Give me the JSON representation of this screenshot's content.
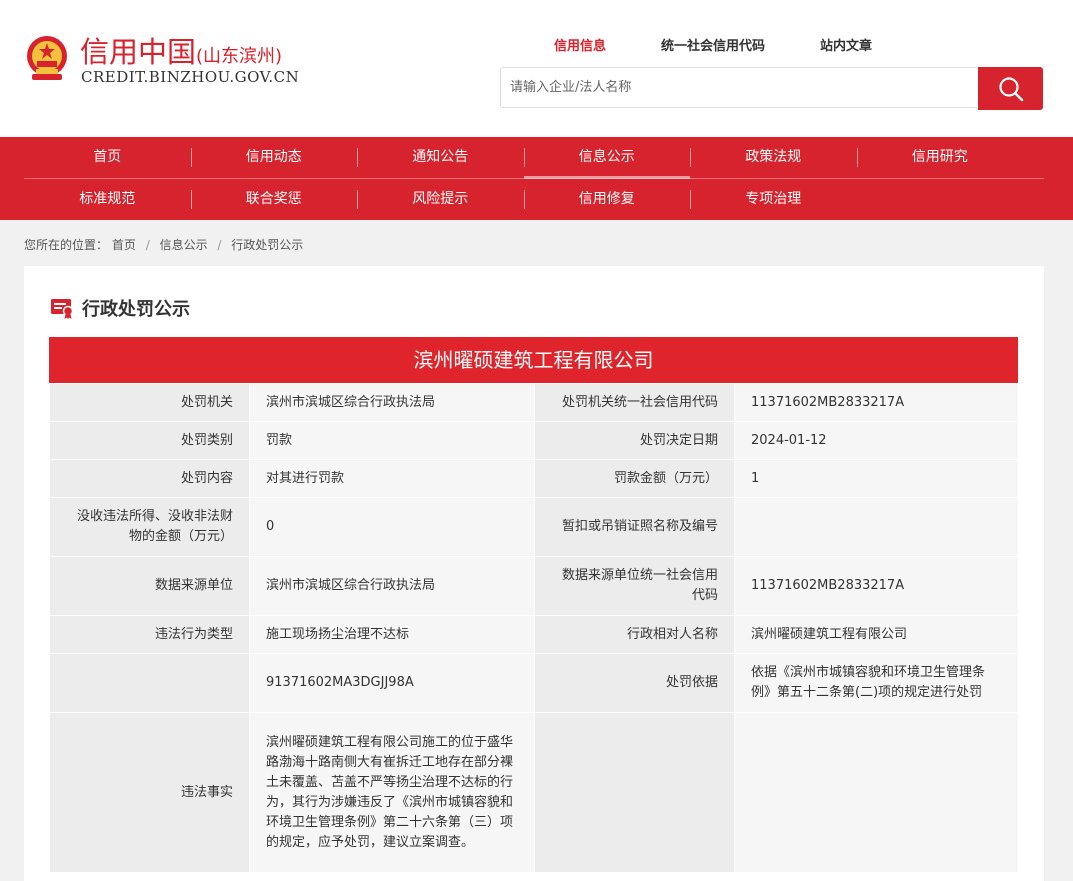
{
  "header": {
    "logo_title": "信用中国",
    "logo_region": "(山东滨州)",
    "logo_url": "CREDIT.BINZHOU.GOV.CN",
    "search_tabs": [
      "信用信息",
      "统一社会信用代码",
      "站内文章"
    ],
    "active_tab": 0,
    "search_placeholder": "请输入企业/法人名称",
    "search_value": ""
  },
  "nav": {
    "row1": [
      "首页",
      "信用动态",
      "通知公告",
      "信息公示",
      "政策法规",
      "信用研究"
    ],
    "row2": [
      "标准规范",
      "联合奖惩",
      "风险提示",
      "信用修复",
      "专项治理"
    ],
    "active": "信息公示"
  },
  "breadcrumb": {
    "prefix": "您所在的位置：",
    "items": [
      "首页",
      "信息公示",
      "行政处罚公示"
    ]
  },
  "panel": {
    "title": "行政处罚公示",
    "company": "滨州曜硕建筑工程有限公司"
  },
  "table": {
    "rows": [
      {
        "l1": "处罚机关",
        "v1": "滨州市滨城区综合行政执法局",
        "l2": "处罚机关统一社会信用代码",
        "v2": "11371602MB2833217A"
      },
      {
        "l1": "处罚类别",
        "v1": "罚款",
        "l2": "处罚决定日期",
        "v2": "2024-01-12"
      },
      {
        "l1": "处罚内容",
        "v1": "对其进行罚款",
        "l2": "罚款金额（万元）",
        "v2": "1"
      },
      {
        "l1": "没收违法所得、没收非法财物的金额（万元）",
        "v1": "0",
        "l2": "暂扣或吊销证照名称及编号",
        "v2": ""
      },
      {
        "l1": "数据来源单位",
        "v1": "滨州市滨城区综合行政执法局",
        "l2": "数据来源单位统一社会信用代码",
        "v2": "11371602MB2833217A"
      },
      {
        "l1": "违法行为类型",
        "v1": "施工现场扬尘治理不达标",
        "l2": "行政相对人名称",
        "v2": "滨州曜硕建筑工程有限公司"
      },
      {
        "l1": "",
        "v1": "91371602MA3DGJJ98A",
        "l2": "处罚依据",
        "v2": "依据《滨州市城镇容貌和环境卫生管理条例》第五十二条第(二)项的规定进行处罚"
      },
      {
        "l1": "违法事实",
        "v1": "滨州曜硕建筑工程有限公司施工的位于盛华路渤海十路南侧大有崔拆迁工地存在部分裸土未覆盖、苫盖不严等扬尘治理不达标的行为，其行为涉嫌违反了《滨州市城镇容貌和环境卫生管理条例》第二十六条第（三）项的规定，应予处罚，建议立案调查。",
        "l2": "",
        "v2": ""
      }
    ]
  },
  "colors": {
    "brand_red": "#d6232d",
    "label_bg": "#ececec",
    "value_bg": "#f6f6f6"
  }
}
